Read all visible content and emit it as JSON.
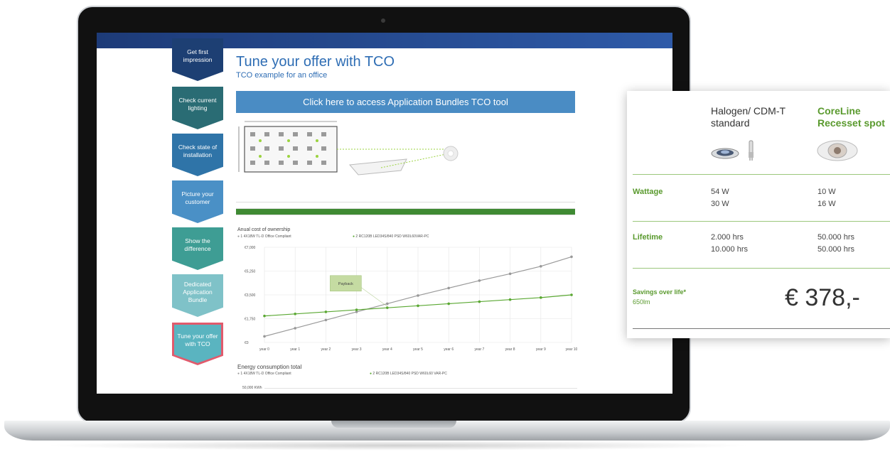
{
  "screen": {
    "steps": [
      {
        "label": "Get first impression",
        "color": "#1d3f73"
      },
      {
        "label": "Check current lighting",
        "color": "#2a6c74"
      },
      {
        "label": "Check state of installation",
        "color": "#2f74a8"
      },
      {
        "label": "Picture your customer",
        "color": "#4a90c6"
      },
      {
        "label": "Show the difference",
        "color": "#3e9d94"
      },
      {
        "label": "Dedicated Application Bundle",
        "color": "#7fc2c8"
      },
      {
        "label": "Tune your offer with TCO",
        "color": "#5ab4c0"
      }
    ],
    "title": "Tune your offer with TCO",
    "subtitle": "TCO example for an office",
    "cta_label": "Click here to access Application Bundles TCO tool",
    "chart_title": "Anual cost of ownership",
    "legend_1": "1 4X18W TL-D Office Compliant",
    "legend_2": "2 RC120B LED34S/840 PSD W60L60VAR-PC",
    "energy_title": "Energy consumption total",
    "energy_legend_1": "1 4X18W TL-D Office Compliant",
    "energy_legend_2": "2 RC120B LED34S/840 PSD W60L60 VAR-PC",
    "energy_axis": "50,000 KWh"
  },
  "chart_data": {
    "type": "line",
    "title": "Anual cost of ownership",
    "categories": [
      "year 0",
      "year 1",
      "year 2",
      "year 3",
      "year 4",
      "year 5",
      "year 6",
      "year 7",
      "year 8",
      "year 9",
      "year 10"
    ],
    "yticks": [
      "€7,000",
      "€5,250",
      "€3,500",
      "€1,750",
      "€0"
    ],
    "ylim": [
      0,
      7000
    ],
    "annotation": "Payback",
    "series": [
      {
        "name": "1 4X18W TL-D Office Compliant",
        "color": "#999999",
        "values": [
          450,
          1050,
          1650,
          2250,
          2850,
          3450,
          4000,
          4550,
          5050,
          5600,
          6300
        ]
      },
      {
        "name": "2 RC120B LED34S/840 PSD W60L60VAR-PC",
        "color": "#5aa832",
        "values": [
          1950,
          2100,
          2250,
          2400,
          2550,
          2700,
          2850,
          3000,
          3150,
          3300,
          3500
        ]
      }
    ]
  },
  "card": {
    "col1_header": "Halogen/ CDM-T standard",
    "col2_header": "CoreLine Recesset spot",
    "rows": [
      {
        "label": "Wattage",
        "col1": [
          "54 W",
          "30 W"
        ],
        "col2": [
          "10 W",
          "16 W"
        ]
      },
      {
        "label": "Lifetime",
        "col1": [
          "2.000 hrs",
          "10.000 hrs"
        ],
        "col2": [
          "50.000 hrs",
          "50.000 hrs"
        ]
      }
    ],
    "savings_label": "Savings over life*",
    "savings_sub": "650lm",
    "savings_value": "€ 378,-"
  }
}
